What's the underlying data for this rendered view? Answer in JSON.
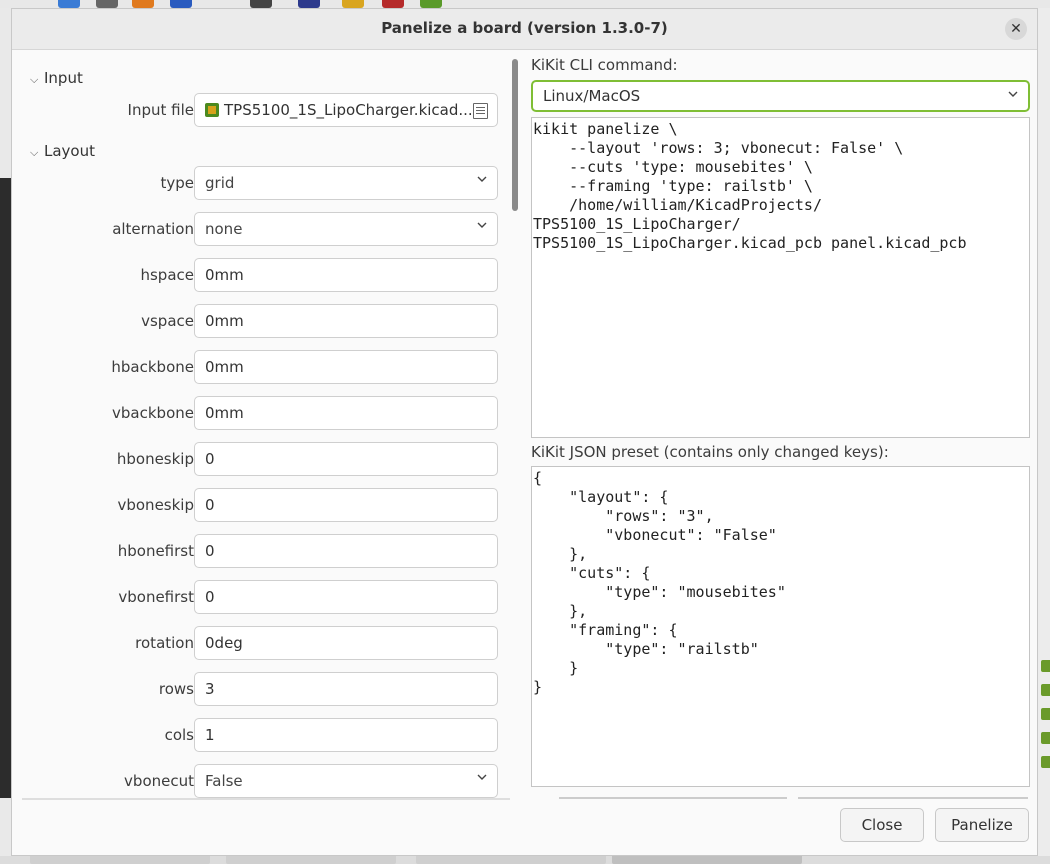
{
  "dialog": {
    "title": "Panelize a board  (version 1.3.0-7)",
    "close_icon": "close-icon"
  },
  "sections": {
    "input": "Input",
    "layout": "Layout"
  },
  "input": {
    "file_label": "Input file",
    "file_value": "TPS5100_1S_LipoCharger.kicad...",
    "file_icon": "pcb-file-icon",
    "browse_icon": "file-browse-icon"
  },
  "layout": {
    "fields": [
      {
        "label": "type",
        "value": "grid",
        "kind": "select"
      },
      {
        "label": "alternation",
        "value": "none",
        "kind": "select"
      },
      {
        "label": "hspace",
        "value": "0mm",
        "kind": "text"
      },
      {
        "label": "vspace",
        "value": "0mm",
        "kind": "text"
      },
      {
        "label": "hbackbone",
        "value": "0mm",
        "kind": "text"
      },
      {
        "label": "vbackbone",
        "value": "0mm",
        "kind": "text"
      },
      {
        "label": "hboneskip",
        "value": "0",
        "kind": "text"
      },
      {
        "label": "vboneskip",
        "value": "0",
        "kind": "text"
      },
      {
        "label": "hbonefirst",
        "value": "0",
        "kind": "text"
      },
      {
        "label": "vbonefirst",
        "value": "0",
        "kind": "text"
      },
      {
        "label": "rotation",
        "value": "0deg",
        "kind": "text"
      },
      {
        "label": "rows",
        "value": "3",
        "kind": "text"
      },
      {
        "label": "cols",
        "value": "1",
        "kind": "text"
      },
      {
        "label": "vbonecut",
        "value": "False",
        "kind": "select"
      }
    ]
  },
  "cli": {
    "label": "KiKit CLI command:",
    "os_selected": "Linux/MacOS",
    "command": "kikit panelize \\\n    --layout 'rows: 3; vbonecut: False' \\\n    --cuts 'type: mousebites' \\\n    --framing 'type: railstb' \\\n    /home/william/KicadProjects/\nTPS5100_1S_LipoCharger/\nTPS5100_1S_LipoCharger.kicad_pcb panel.kicad_pcb"
  },
  "preset": {
    "label": "KiKit JSON preset (contains only changed keys):",
    "json": "{\n    \"layout\": {\n        \"rows\": \"3\",\n        \"vbonecut\": \"False\"\n    },\n    \"cuts\": {\n        \"type\": \"mousebites\"\n    },\n    \"framing\": {\n        \"type\": \"railstb\"\n    }\n}"
  },
  "buttons": {
    "close": "Close",
    "panelize": "Panelize"
  },
  "colors": {
    "accent_focus": "#7fbe35",
    "dialog_bg": "#fafafa"
  }
}
